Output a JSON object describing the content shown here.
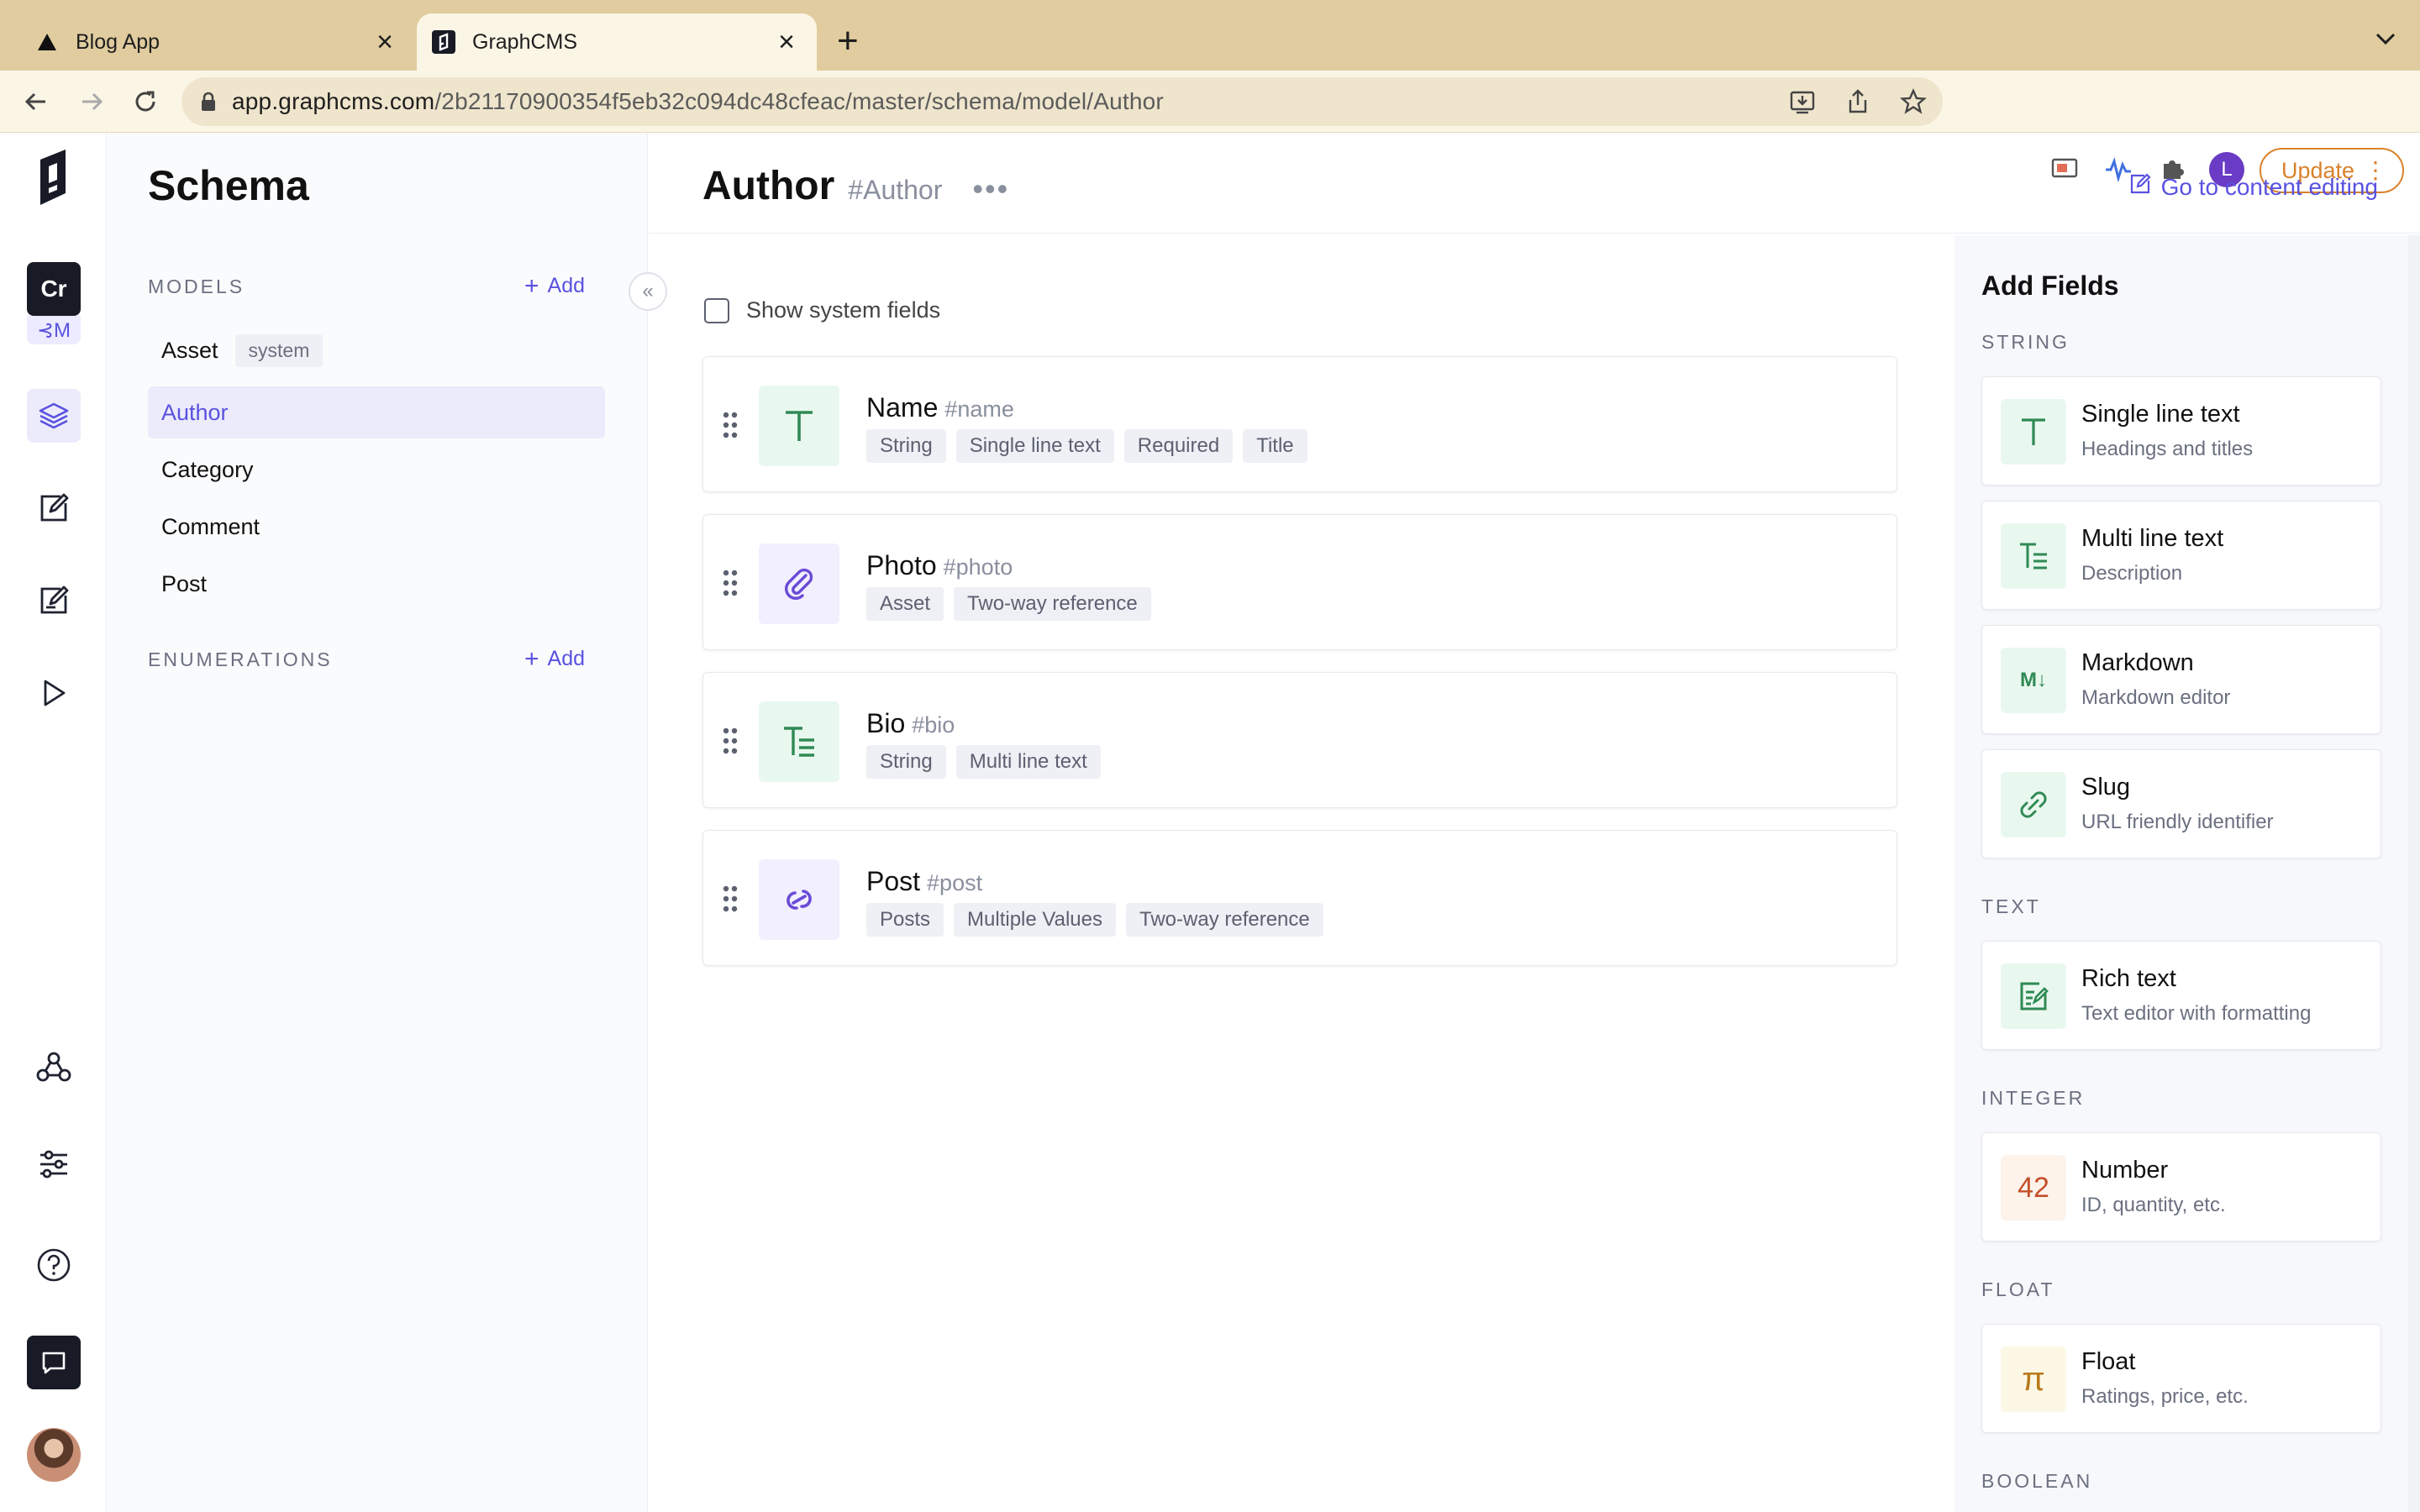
{
  "browser": {
    "tabs": [
      {
        "title": "Blog App",
        "active": false
      },
      {
        "title": "GraphCMS",
        "active": true
      }
    ],
    "url_host": "app.graphcms.com",
    "url_path": "/2b21170900354f5eb32c094dc48cfeac/master/schema/model/Author",
    "profile_initial": "L",
    "update_label": "Update"
  },
  "rail": {
    "project_initials": "Cr",
    "environment_label": "⊰M"
  },
  "sidebar": {
    "title": "Schema",
    "models_label": "MODELS",
    "add_label": "Add",
    "models": [
      {
        "name": "Asset",
        "badge": "system",
        "active": false
      },
      {
        "name": "Author",
        "badge": "",
        "active": true
      },
      {
        "name": "Category",
        "badge": "",
        "active": false
      },
      {
        "name": "Comment",
        "badge": "",
        "active": false
      },
      {
        "name": "Post",
        "badge": "",
        "active": false
      }
    ],
    "enumerations_label": "ENUMERATIONS"
  },
  "main": {
    "title": "Author",
    "api_id": "#Author",
    "more": "•••",
    "go_content_label": "Go to content editing",
    "show_system_fields_label": "Show system fields",
    "fields": [
      {
        "name": "Name",
        "api_id": "#name",
        "tags": [
          "String",
          "Single line text",
          "Required",
          "Title"
        ],
        "icon": "text-t-icon"
      },
      {
        "name": "Photo",
        "api_id": "#photo",
        "tags": [
          "Asset",
          "Two-way reference"
        ],
        "icon": "paperclip-icon"
      },
      {
        "name": "Bio",
        "api_id": "#bio",
        "tags": [
          "String",
          "Multi line text"
        ],
        "icon": "multiline-text-icon"
      },
      {
        "name": "Post",
        "api_id": "#post",
        "tags": [
          "Posts",
          "Multiple Values",
          "Two-way reference"
        ],
        "icon": "link-icon"
      }
    ]
  },
  "panel": {
    "title": "Add Fields",
    "sections": {
      "string": "STRING",
      "text": "TEXT",
      "integer": "INTEGER",
      "float": "FLOAT",
      "boolean": "BOOLEAN"
    },
    "cards": [
      {
        "name": "Single line text",
        "desc": "Headings and titles"
      },
      {
        "name": "Multi line text",
        "desc": "Description"
      },
      {
        "name": "Markdown",
        "desc": "Markdown editor"
      },
      {
        "name": "Slug",
        "desc": "URL friendly identifier"
      },
      {
        "name": "Rich text",
        "desc": "Text editor with formatting"
      },
      {
        "name": "Number",
        "desc": "ID, quantity, etc.",
        "glyph": "42"
      },
      {
        "name": "Float",
        "desc": "Ratings, price, etc.",
        "glyph": "π"
      }
    ],
    "markdown_glyph": "M↓"
  },
  "colors": {
    "accent": "#5a52e0",
    "tabbar": "#e0cc9e",
    "update": "#d9822b",
    "string_green": "#2f8a55"
  }
}
